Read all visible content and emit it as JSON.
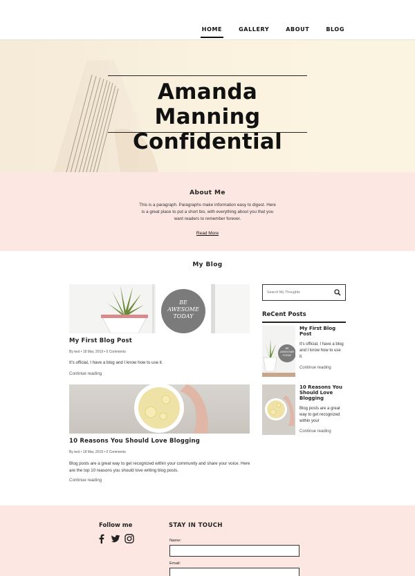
{
  "nav": {
    "items": [
      {
        "label": "HOME",
        "active": true
      },
      {
        "label": "GALLERY",
        "active": false
      },
      {
        "label": "ABOUT",
        "active": false
      },
      {
        "label": "BLOG",
        "active": false
      }
    ]
  },
  "hero": {
    "title_line1": "Amanda Manning",
    "title_line2": "Confidential"
  },
  "about": {
    "heading": "About Me",
    "paragraph": "This is a paragraph. Paragraphs make information easy to digest. Here is a great place to put a short bio, with everything about you that you want readers to remember forever.",
    "link": "Read More"
  },
  "blog": {
    "heading": "My Blog",
    "posts": [
      {
        "title": "My First Blog Post",
        "meta": "By test • 18 Mar, 2019 • 0 Comments",
        "excerpt": "It's official, I have a blog and I know how to use it.",
        "more": "Continue reading",
        "image_text": "BE AWESOME TODAY"
      },
      {
        "title": "10 Reasons You Should Love Blogging",
        "meta": "By test • 18 Mar, 2019 • 0 Comments",
        "excerpt": "Blog posts are a great way to get recognized within your community and share your voice. Here are the top 10 reasons you should love writing blog posts.",
        "more": "Continue reading"
      }
    ]
  },
  "sidebar": {
    "search_placeholder": "Search My Thoughts",
    "recent_heading": "ReCent Posts",
    "recent": [
      {
        "title": "My First Blog Post",
        "excerpt": "It's official, I have a blog and I know how to use it.",
        "more": "Continue reading",
        "image_text": "BE AWESOME TODAY"
      },
      {
        "title": "10 Reasons You Should Love Blogging",
        "excerpt": "Blog posts are a great way to get recognized within your",
        "more": "Continue reading"
      }
    ]
  },
  "footer": {
    "follow_heading": "Follow me",
    "social_icons": [
      "facebook-icon",
      "twitter-icon",
      "instagram-icon"
    ],
    "stay_heading": "STAY IN TOUCH",
    "name_label": "Name:",
    "email_label": "Email:"
  },
  "colors": {
    "pink_band": "#fde7e3",
    "hero_bg": "#fbf3df",
    "text": "#222222"
  }
}
